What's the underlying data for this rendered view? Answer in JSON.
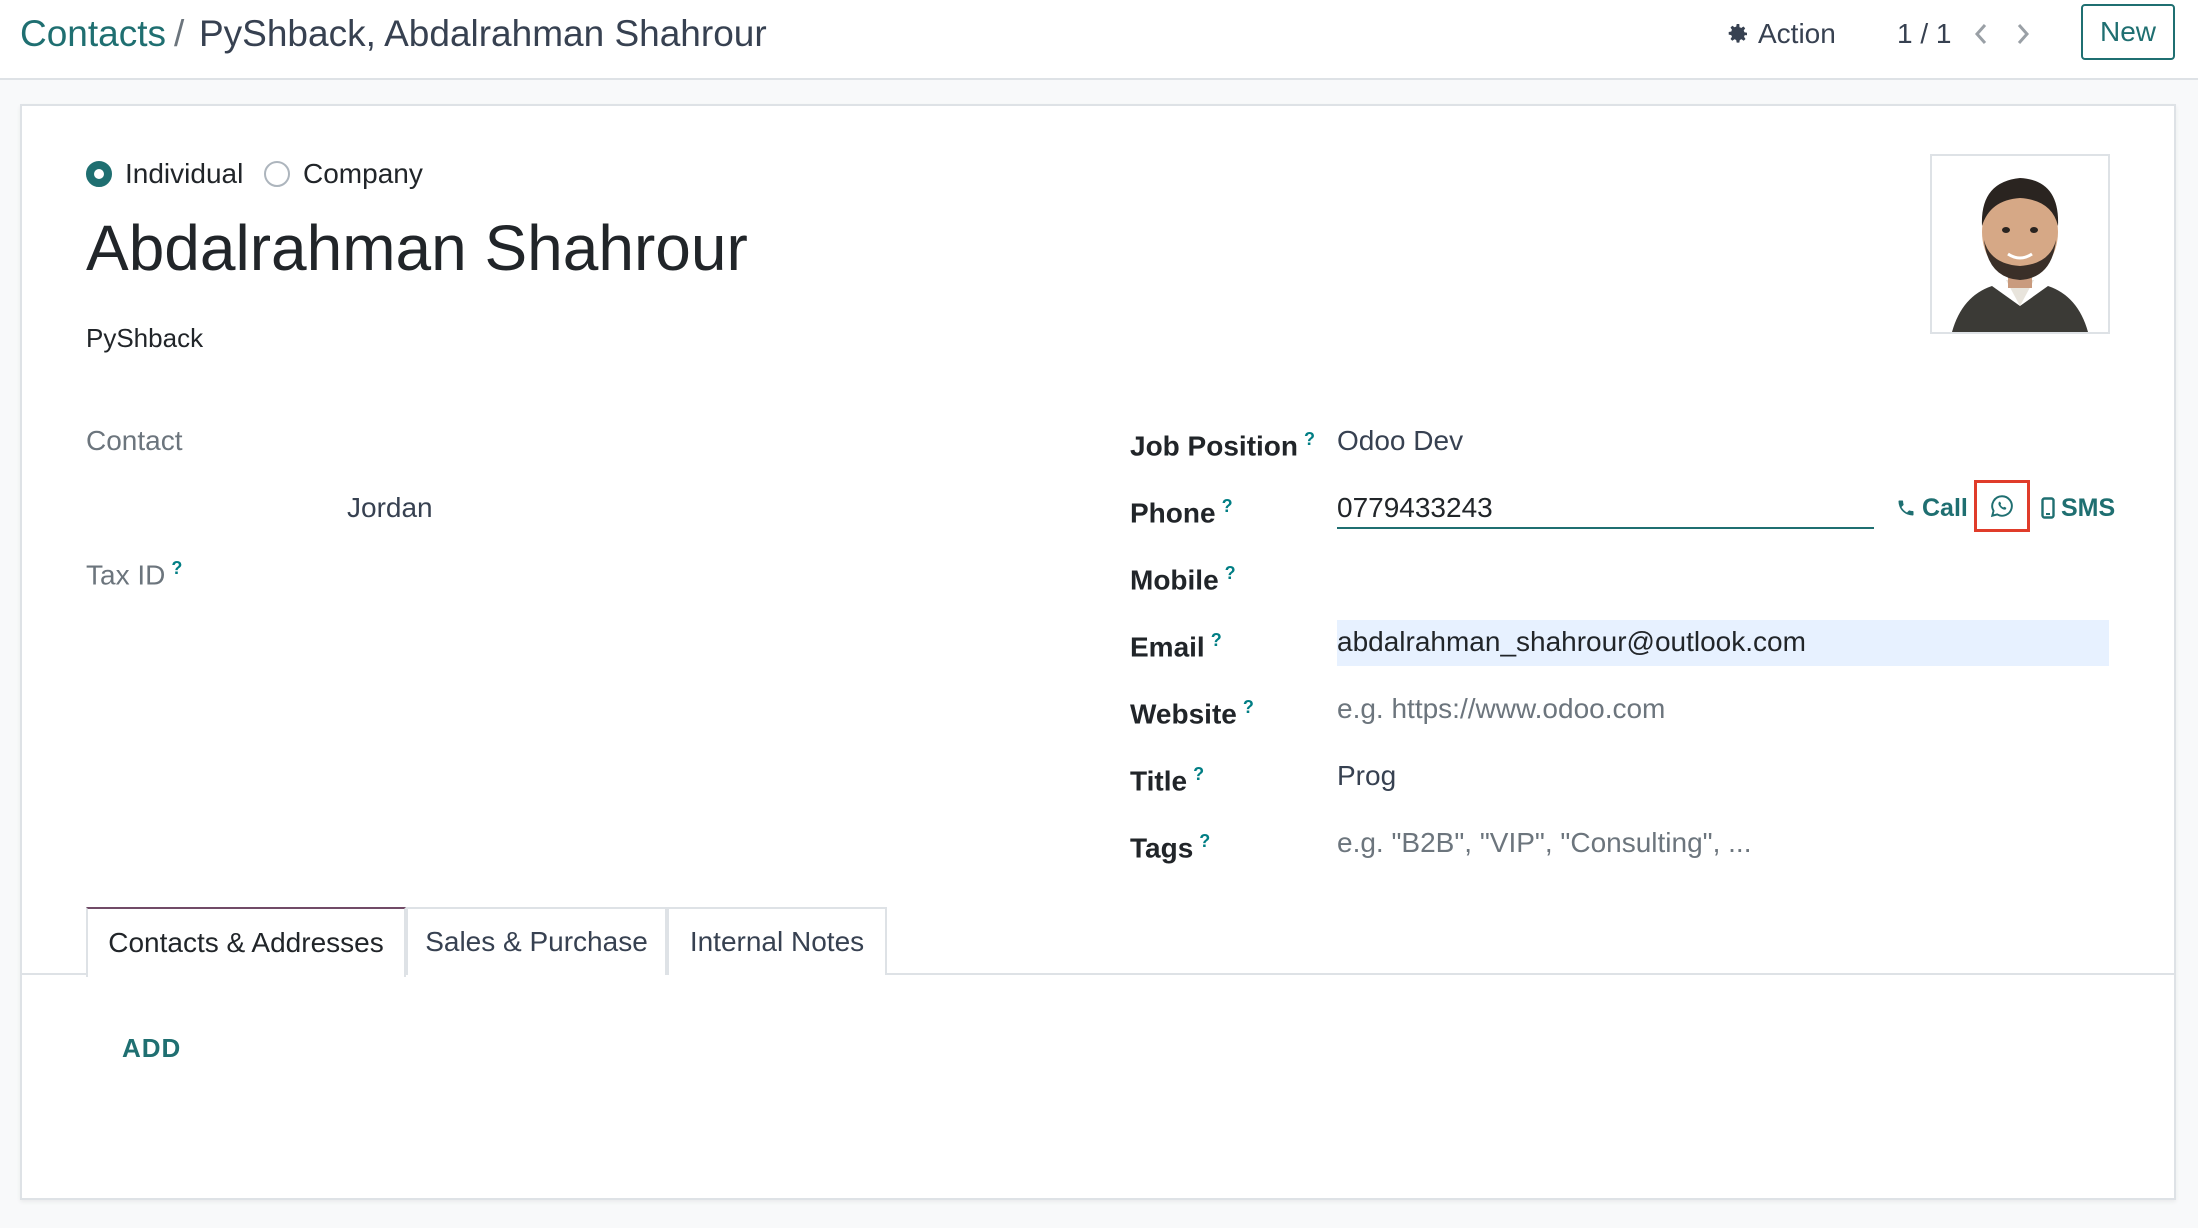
{
  "breadcrumb": {
    "parent": "Contacts",
    "separator": "/",
    "current": "PyShback, Abdalrahman Shahrour"
  },
  "toolbar": {
    "action_label": "Action",
    "pager": "1 / 1",
    "new_label": "New"
  },
  "form": {
    "type_options": [
      {
        "label": "Individual",
        "selected": true
      },
      {
        "label": "Company",
        "selected": false
      }
    ],
    "name": "Abdalrahman Shahrour",
    "company": "PyShback",
    "left": {
      "contact_label": "Contact",
      "country": "Jordan",
      "tax_id_label": "Tax ID",
      "help_mark": "?"
    },
    "right": {
      "job_position": {
        "label": "Job Position",
        "value": "Odoo Dev"
      },
      "phone": {
        "label": "Phone",
        "value": "0779433243"
      },
      "mobile": {
        "label": "Mobile",
        "value": ""
      },
      "email": {
        "label": "Email",
        "value": "abdalrahman_shahrour@outlook.com"
      },
      "website": {
        "label": "Website",
        "placeholder": "e.g. https://www.odoo.com"
      },
      "title": {
        "label": "Title",
        "value": "Prog"
      },
      "tags": {
        "label": "Tags",
        "placeholder": "e.g. \"B2B\", \"VIP\", \"Consulting\", ..."
      }
    },
    "phone_actions": {
      "call_label": "Call",
      "sms_label": "SMS"
    }
  },
  "tabs": [
    {
      "label": "Contacts & Addresses",
      "active": true
    },
    {
      "label": "Sales & Purchase",
      "active": false
    },
    {
      "label": "Internal Notes",
      "active": false
    }
  ],
  "tab_content": {
    "add_label": "ADD"
  },
  "colors": {
    "accent": "#1f6f71",
    "highlight_border": "#e03c2a",
    "active_tab_border": "#714b67",
    "email_highlight": "#e7f1ff"
  },
  "icons": [
    "gear-icon",
    "chevron-left-icon",
    "chevron-right-icon",
    "phone-icon",
    "whatsapp-icon",
    "mobile-icon"
  ]
}
